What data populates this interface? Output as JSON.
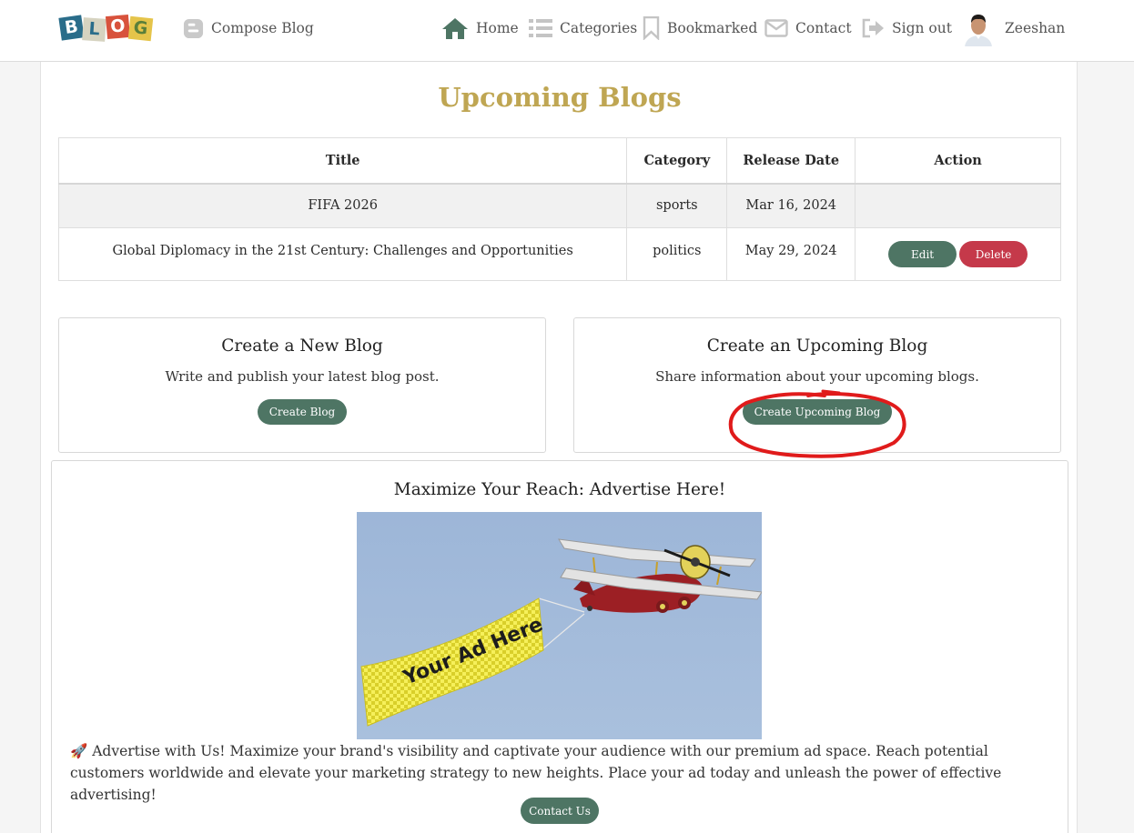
{
  "navbar": {
    "logo_letters": [
      "B",
      "L",
      "O",
      "G"
    ],
    "logo_colors": [
      "#2a6d8a",
      "#d6d3c0",
      "#d8523c",
      "#e5c44a"
    ],
    "compose": {
      "label": "Compose Blog",
      "icon": "blogger-icon"
    },
    "links": [
      {
        "label": "Home",
        "icon": "home-icon"
      },
      {
        "label": "Categories",
        "icon": "list-icon"
      },
      {
        "label": "Bookmarked",
        "icon": "bookmark-icon"
      },
      {
        "label": "Contact",
        "icon": "envelope-icon"
      },
      {
        "label": "Sign out",
        "icon": "sign-out-icon"
      }
    ],
    "user": {
      "name": "Zeeshan",
      "icon": "avatar"
    }
  },
  "page": {
    "title": "Upcoming Blogs"
  },
  "table": {
    "headers": [
      "Title",
      "Category",
      "Release Date",
      "Action"
    ],
    "rows": [
      {
        "title": "FIFA 2026",
        "category": "sports",
        "release_date": "Mar 16, 2024",
        "actions": []
      },
      {
        "title": "Global Diplomacy in the 21st Century: Challenges and Opportunities",
        "category": "politics",
        "release_date": "May 29, 2024",
        "actions": [
          "Edit",
          "Delete"
        ]
      }
    ]
  },
  "cards": {
    "new_blog": {
      "title": "Create a New Blog",
      "description": "Write and publish your latest blog post.",
      "button": "Create Blog"
    },
    "upcoming_blog": {
      "title": "Create an Upcoming Blog",
      "description": "Share information about your upcoming blogs.",
      "button": "Create Upcoming Blog"
    }
  },
  "ad": {
    "heading": "Maximize Your Reach: Advertise Here!",
    "banner_text": "Your Ad Here",
    "text": "🚀 Advertise with Us! Maximize your brand's visibility and captivate your audience with our premium ad space. Reach potential customers worldwide and elevate your marketing strategy to new heights. Place your ad today and unleash the power of effective advertising!",
    "button": "Contact Us"
  },
  "colors": {
    "accent_gold": "#bfa653",
    "button_green": "#4e7564",
    "button_red": "#c5394a",
    "annotation_red": "#e01b1b"
  }
}
